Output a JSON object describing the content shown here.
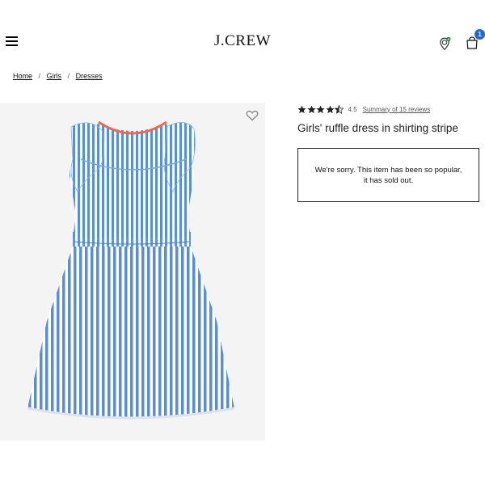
{
  "header": {
    "logo": "J.CREW",
    "bag_count": "1",
    "accent_color": "#1b6ad6",
    "icons": [
      "menu-icon",
      "location-pin-icon",
      "shopping-bag-icon"
    ]
  },
  "breadcrumb": {
    "items": [
      "Home",
      "Girls",
      "Dresses"
    ],
    "separator": "/"
  },
  "product": {
    "image_icon": "striped-dress-image",
    "wishlist_icon": "heart-icon",
    "rating_value": "4.5",
    "rating_stars": 4.5,
    "reviews_link": "Summary of 15 reviews",
    "title": "Girls' ruffle dress in shirting stripe",
    "sold_out_message": "We're sorry. This item has been so popular, it has sold out."
  }
}
